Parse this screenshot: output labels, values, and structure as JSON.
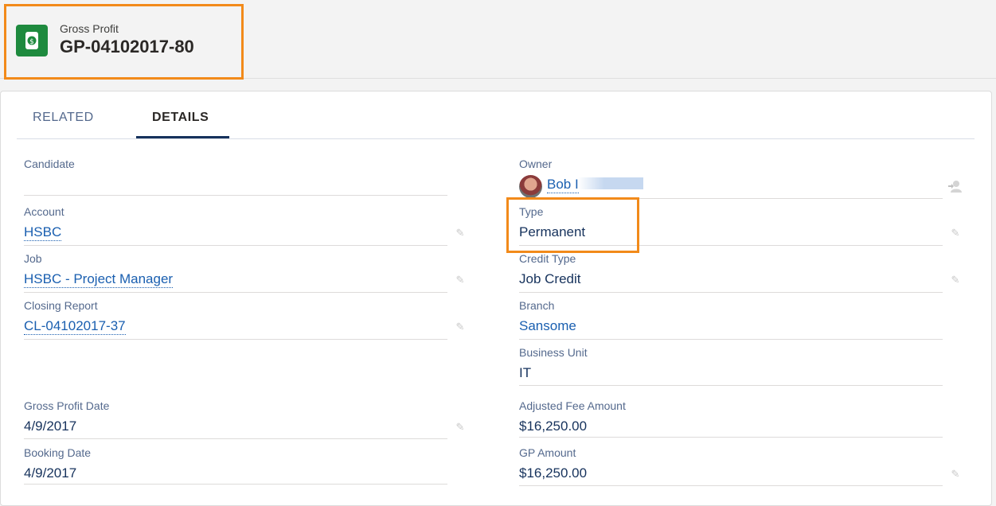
{
  "header": {
    "object_type": "Gross Profit",
    "record_name": "GP-04102017-80"
  },
  "tabs": [
    {
      "label": "RELATED",
      "active": false
    },
    {
      "label": "DETAILS",
      "active": true
    }
  ],
  "left_fields": [
    {
      "label": "Candidate",
      "value": ""
    },
    {
      "label": "Account",
      "value": "HSBC"
    },
    {
      "label": "Job",
      "value": "HSBC - Project Manager"
    },
    {
      "label": "Closing Report",
      "value": "CL-04102017-37"
    },
    {
      "label": "Gross Profit Date",
      "value": "4/9/2017"
    },
    {
      "label": "Booking Date",
      "value": "4/9/2017"
    }
  ],
  "right_fields": [
    {
      "label": "Owner",
      "value": "Bob I"
    },
    {
      "label": "Type",
      "value": "Permanent"
    },
    {
      "label": "Credit Type",
      "value": "Job Credit"
    },
    {
      "label": "Branch",
      "value": "Sansome"
    },
    {
      "label": "Business Unit",
      "value": "IT"
    },
    {
      "label": "Adjusted Fee Amount",
      "value": "$16,250.00"
    },
    {
      "label": "GP Amount",
      "value": "$16,250.00"
    }
  ],
  "colors": {
    "highlight": "#f28a1a",
    "icon_bg": "#1e8a3e",
    "link": "#1a5fb0"
  },
  "icons": {
    "object_icon": "money-icon",
    "edit_icon": "pencil-icon",
    "owner_change": "change-owner-icon"
  }
}
